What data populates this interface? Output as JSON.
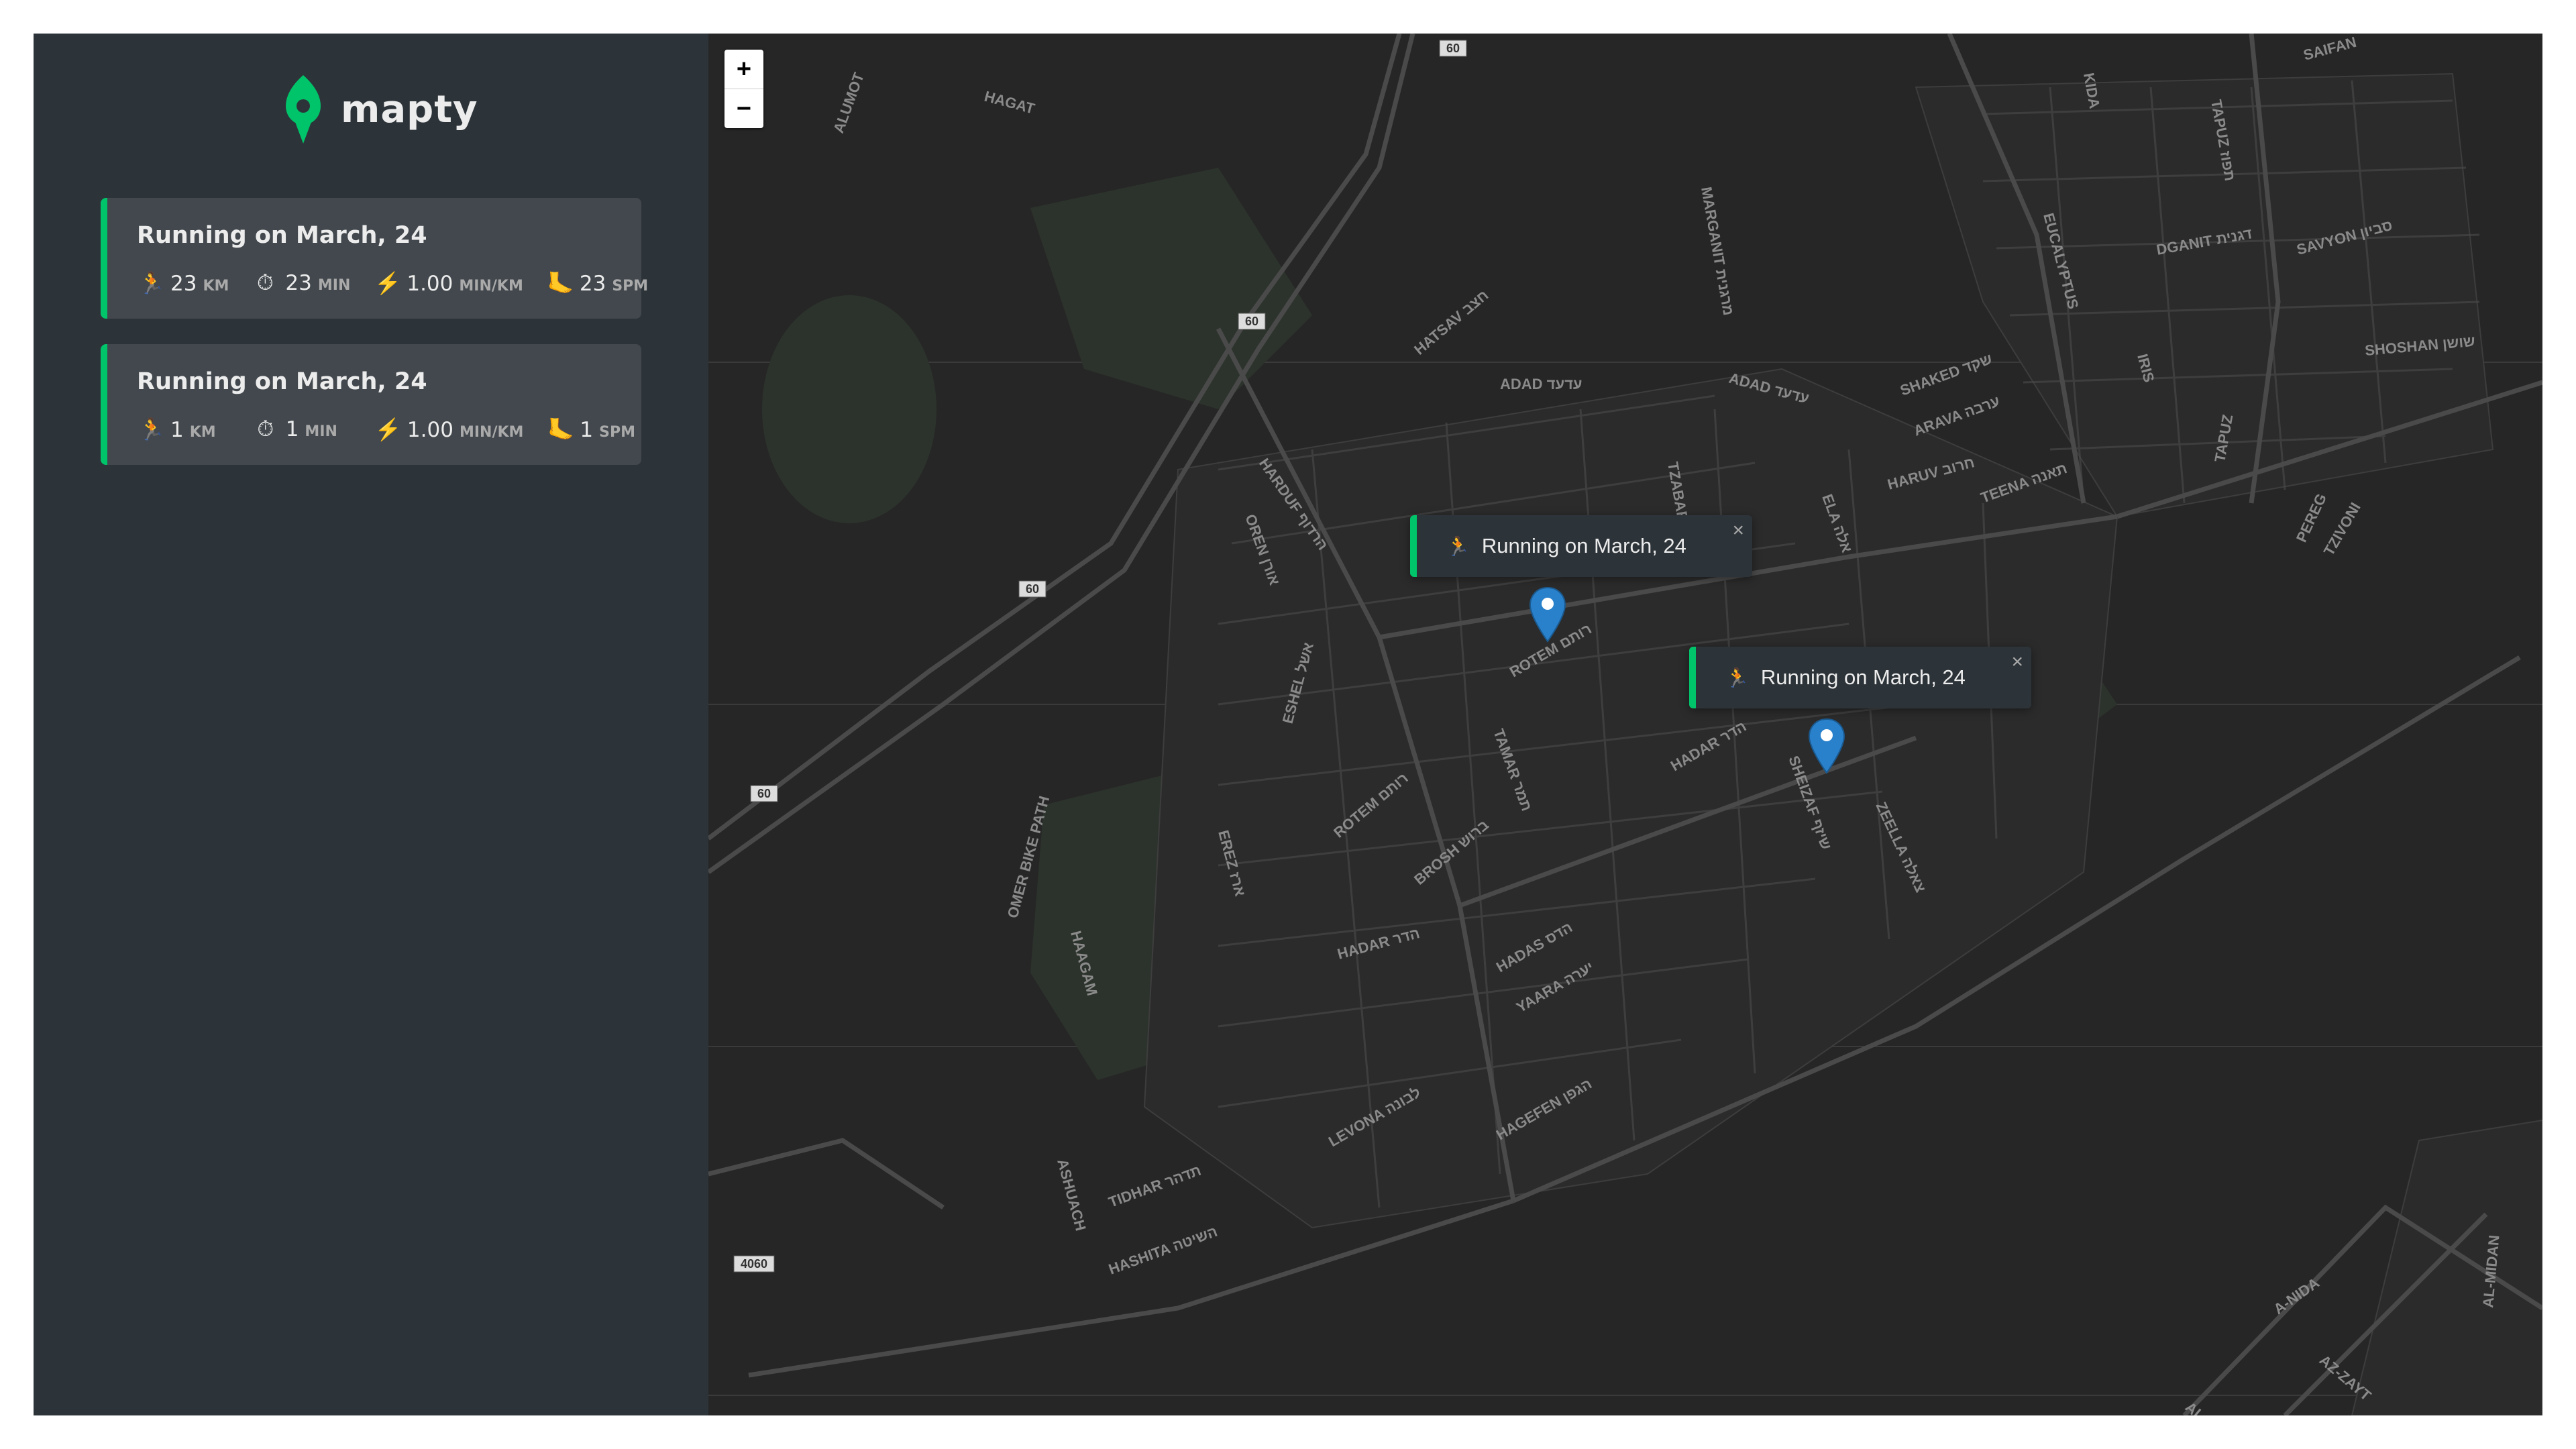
{
  "app": {
    "logo_text": "mapty"
  },
  "workouts": [
    {
      "title": "Running on March, 24",
      "distance": "23",
      "distance_unit": "km",
      "duration": "23",
      "duration_unit": "min",
      "pace": "1.00",
      "pace_unit": "min/km",
      "cadence": "23",
      "cadence_unit": "spm"
    },
    {
      "title": "Running on March, 24",
      "distance": "1",
      "distance_unit": "km",
      "duration": "1",
      "duration_unit": "min",
      "pace": "1.00",
      "pace_unit": "min/km",
      "cadence": "1",
      "cadence_unit": "spm"
    }
  ],
  "map": {
    "zoom_in": "+",
    "zoom_out": "−",
    "popups": [
      {
        "label": "Running on March, 24",
        "close": "×"
      },
      {
        "label": "Running on March, 24",
        "close": "×"
      }
    ],
    "road_labels": [
      "HATSAV חצב",
      "ADAD עדעד",
      "ADAD עדעד",
      "MARGANIT מרגנית",
      "TZABAR",
      "HARDUF הרדוף",
      "OREN אורן",
      "ROTEM רותם",
      "ESHEL אשל",
      "TAMAR תמר",
      "HADAR הדר",
      "SHEIZAF שיזף",
      "ZEELLA צאלה",
      "EREZ ארז",
      "ROTEM רותם",
      "BROSH ברוש",
      "HADAR הדר",
      "HADAS הדס",
      "YAARA יערה",
      "LEVONA לבונה",
      "TIDHAR תדהר",
      "HASHITA השיטה",
      "HAGEFEN הגפן",
      "ASHUACH",
      "HAAGAM",
      "OMER BIKE PATH",
      "SHAKED שקד",
      "ARAVA ערבה",
      "HARUV חרוב",
      "TEENA תאנה",
      "ELA אלה",
      "EUCALYPTUS",
      "IRIS",
      "DGANIT דגנית",
      "SAVYON סביון",
      "SHOSHAN שושן",
      "TAPUZ תפוז",
      "PEREG",
      "TZIVONI",
      "KIDA",
      "SAIFAN",
      "HAGAT",
      "ALUMOT",
      "AL-MIDAN",
      "A-NIDA",
      "AZ-ZAYT",
      "AL-YASM"
    ],
    "route_shields": [
      "60",
      "60",
      "60",
      "60",
      "4060"
    ]
  },
  "icons": {
    "run": "🏃",
    "clock": "⏱",
    "bolt": "⚡",
    "foot": "🦶"
  },
  "colors": {
    "accent": "#00c46a",
    "sidebar": "#2d3439",
    "card": "#42484d",
    "map_bg": "#262626",
    "pin": "#2a81cb"
  }
}
